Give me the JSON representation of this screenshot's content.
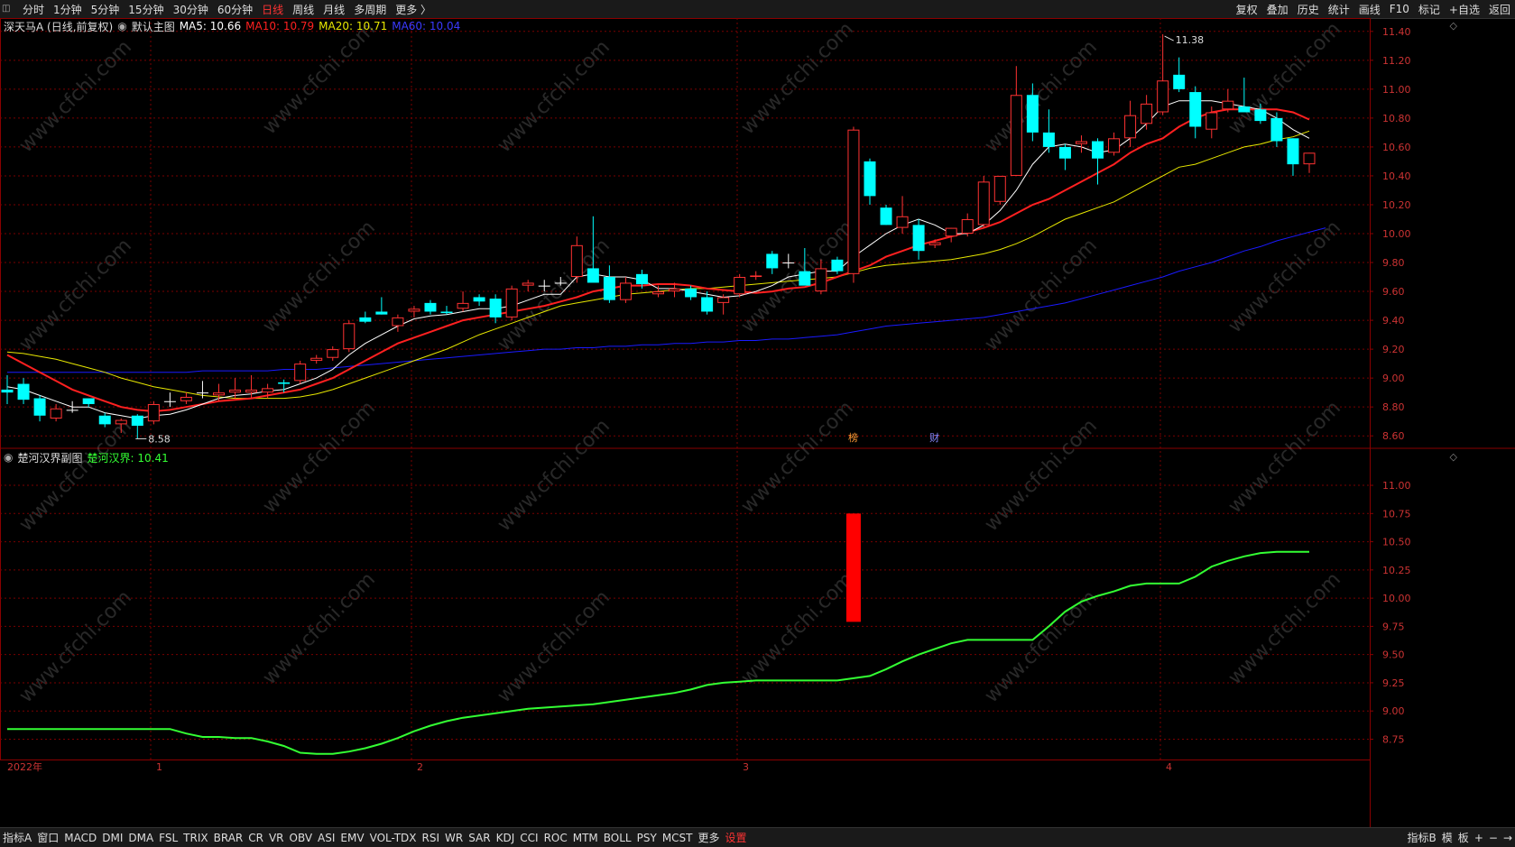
{
  "topbar": {
    "periods": [
      "分时",
      "1分钟",
      "5分钟",
      "15分钟",
      "30分钟",
      "60分钟",
      "日线",
      "周线",
      "月线",
      "多周期",
      "更多 〉"
    ],
    "active_period": "日线",
    "right_items": [
      "复权",
      "叠加",
      "历史",
      "统计",
      "画线",
      "F10",
      "标记",
      "+自选",
      "返回"
    ]
  },
  "main_legend": {
    "stock": "深天马A (日线,前复权)",
    "template": "默认主图",
    "ma5": "MA5: 10.66",
    "ma10": "MA10: 10.79",
    "ma20": "MA20: 10.71",
    "ma60": "MA60: 10.04"
  },
  "sub_legend": {
    "name": "楚河汉界副图",
    "value": "楚河汉界: 10.41"
  },
  "annotations": {
    "high": "11.38",
    "low": "8.58",
    "markers": [
      "榜",
      "财"
    ]
  },
  "x_labels": [
    "2022年",
    "1",
    "2",
    "3",
    "4"
  ],
  "main_y_ticks": [
    "11.40",
    "11.20",
    "11.00",
    "10.80",
    "10.60",
    "10.40",
    "10.20",
    "10.00",
    "9.80",
    "9.60",
    "9.40",
    "9.20",
    "9.00",
    "8.80",
    "8.60"
  ],
  "sub_y_ticks": [
    "11.00",
    "10.75",
    "10.50",
    "10.25",
    "10.00",
    "9.75",
    "9.50",
    "9.25",
    "9.00",
    "8.75"
  ],
  "watermark": "www.cfchi.com",
  "period_tag": "日线",
  "bottombar": {
    "items": [
      "指标A",
      "窗口",
      "MACD",
      "DMI",
      "DMA",
      "FSL",
      "TRIX",
      "BRAR",
      "CR",
      "VR",
      "OBV",
      "ASI",
      "EMV",
      "VOL-TDX",
      "RSI",
      "WR",
      "SAR",
      "KDJ",
      "CCI",
      "ROC",
      "MTM",
      "BOLL",
      "PSY",
      "MCST",
      "更多",
      "设置"
    ],
    "active": "设置",
    "right_items": [
      "指标B",
      "模",
      "板",
      "+",
      "−",
      "→"
    ]
  },
  "colors": {
    "up": "#ff3232",
    "down": "#00ffff",
    "ma5": "#ffffff",
    "ma10": "#ff2020",
    "ma20": "#e8e800",
    "ma60": "#1a1aff",
    "sub_line": "#33ff33",
    "grid": "#7a0000"
  },
  "chart_data": [
    {
      "type": "candlestick",
      "title": "深天马A (日线,前复权)",
      "ylim": [
        8.52,
        11.48
      ],
      "candles": [
        {
          "o": 8.92,
          "h": 9.02,
          "l": 8.82,
          "c": 8.9
        },
        {
          "o": 8.96,
          "h": 9.0,
          "l": 8.82,
          "c": 8.85
        },
        {
          "o": 8.86,
          "h": 8.88,
          "l": 8.7,
          "c": 8.74
        },
        {
          "o": 8.72,
          "h": 8.82,
          "l": 8.7,
          "c": 8.79
        },
        {
          "o": 8.78,
          "h": 8.84,
          "l": 8.76,
          "c": 8.78
        },
        {
          "o": 8.86,
          "h": 8.86,
          "l": 8.8,
          "c": 8.82
        },
        {
          "o": 8.74,
          "h": 8.76,
          "l": 8.66,
          "c": 8.68
        },
        {
          "o": 8.68,
          "h": 8.72,
          "l": 8.62,
          "c": 8.71
        },
        {
          "o": 8.74,
          "h": 8.75,
          "l": 8.58,
          "c": 8.67
        },
        {
          "o": 8.7,
          "h": 8.84,
          "l": 8.68,
          "c": 8.82
        },
        {
          "o": 8.84,
          "h": 8.9,
          "l": 8.8,
          "c": 8.84
        },
        {
          "o": 8.84,
          "h": 8.9,
          "l": 8.82,
          "c": 8.87
        },
        {
          "o": 8.9,
          "h": 8.98,
          "l": 8.86,
          "c": 8.9
        },
        {
          "o": 8.88,
          "h": 8.96,
          "l": 8.84,
          "c": 8.9
        },
        {
          "o": 8.9,
          "h": 9.0,
          "l": 8.86,
          "c": 8.92
        },
        {
          "o": 8.9,
          "h": 9.02,
          "l": 8.86,
          "c": 8.92
        },
        {
          "o": 8.9,
          "h": 8.96,
          "l": 8.86,
          "c": 8.93
        },
        {
          "o": 8.97,
          "h": 8.99,
          "l": 8.9,
          "c": 8.96
        },
        {
          "o": 8.98,
          "h": 9.12,
          "l": 8.96,
          "c": 9.1
        },
        {
          "o": 9.12,
          "h": 9.16,
          "l": 9.1,
          "c": 9.14
        },
        {
          "o": 9.14,
          "h": 9.22,
          "l": 9.12,
          "c": 9.2
        },
        {
          "o": 9.2,
          "h": 9.4,
          "l": 9.18,
          "c": 9.38
        },
        {
          "o": 9.42,
          "h": 9.46,
          "l": 9.38,
          "c": 9.39
        },
        {
          "o": 9.46,
          "h": 9.56,
          "l": 9.44,
          "c": 9.44
        },
        {
          "o": 9.36,
          "h": 9.44,
          "l": 9.32,
          "c": 9.42
        },
        {
          "o": 9.46,
          "h": 9.5,
          "l": 9.42,
          "c": 9.48
        },
        {
          "o": 9.52,
          "h": 9.54,
          "l": 9.44,
          "c": 9.46
        },
        {
          "o": 9.46,
          "h": 9.5,
          "l": 9.44,
          "c": 9.45
        },
        {
          "o": 9.48,
          "h": 9.6,
          "l": 9.46,
          "c": 9.52
        },
        {
          "o": 9.56,
          "h": 9.58,
          "l": 9.5,
          "c": 9.53
        },
        {
          "o": 9.55,
          "h": 9.58,
          "l": 9.38,
          "c": 9.42
        },
        {
          "o": 9.42,
          "h": 9.64,
          "l": 9.4,
          "c": 9.62
        },
        {
          "o": 9.64,
          "h": 9.68,
          "l": 9.6,
          "c": 9.66
        },
        {
          "o": 9.64,
          "h": 9.68,
          "l": 9.6,
          "c": 9.64
        },
        {
          "o": 9.66,
          "h": 9.7,
          "l": 9.64,
          "c": 9.66
        },
        {
          "o": 9.7,
          "h": 9.98,
          "l": 9.66,
          "c": 9.92
        },
        {
          "o": 9.76,
          "h": 10.12,
          "l": 9.72,
          "c": 9.66
        },
        {
          "o": 9.7,
          "h": 9.78,
          "l": 9.52,
          "c": 9.54
        },
        {
          "o": 9.54,
          "h": 9.7,
          "l": 9.52,
          "c": 9.66
        },
        {
          "o": 9.72,
          "h": 9.75,
          "l": 9.62,
          "c": 9.65
        },
        {
          "o": 9.58,
          "h": 9.64,
          "l": 9.56,
          "c": 9.6
        },
        {
          "o": 9.6,
          "h": 9.66,
          "l": 9.56,
          "c": 9.62
        },
        {
          "o": 9.62,
          "h": 9.64,
          "l": 9.54,
          "c": 9.56
        },
        {
          "o": 9.56,
          "h": 9.6,
          "l": 9.44,
          "c": 9.46
        },
        {
          "o": 9.52,
          "h": 9.58,
          "l": 9.44,
          "c": 9.56
        },
        {
          "o": 9.58,
          "h": 9.72,
          "l": 9.56,
          "c": 9.7
        },
        {
          "o": 9.7,
          "h": 9.74,
          "l": 9.68,
          "c": 9.71
        },
        {
          "o": 9.86,
          "h": 9.88,
          "l": 9.72,
          "c": 9.76
        },
        {
          "o": 9.8,
          "h": 9.86,
          "l": 9.76,
          "c": 9.8
        },
        {
          "o": 9.74,
          "h": 9.9,
          "l": 9.7,
          "c": 9.64
        },
        {
          "o": 9.6,
          "h": 9.82,
          "l": 9.58,
          "c": 9.76
        },
        {
          "o": 9.82,
          "h": 9.84,
          "l": 9.72,
          "c": 9.74
        },
        {
          "o": 9.72,
          "h": 10.74,
          "l": 9.66,
          "c": 10.72
        },
        {
          "o": 10.5,
          "h": 10.52,
          "l": 10.2,
          "c": 10.26
        },
        {
          "o": 10.18,
          "h": 10.2,
          "l": 10.06,
          "c": 10.06
        },
        {
          "o": 10.04,
          "h": 10.26,
          "l": 10.0,
          "c": 10.12
        },
        {
          "o": 10.06,
          "h": 10.1,
          "l": 9.82,
          "c": 9.88
        },
        {
          "o": 9.92,
          "h": 9.96,
          "l": 9.9,
          "c": 9.94
        },
        {
          "o": 9.98,
          "h": 10.04,
          "l": 9.94,
          "c": 10.04
        },
        {
          "o": 10.0,
          "h": 10.14,
          "l": 9.98,
          "c": 10.1
        },
        {
          "o": 10.06,
          "h": 10.4,
          "l": 10.04,
          "c": 10.36
        },
        {
          "o": 10.22,
          "h": 10.4,
          "l": 10.2,
          "c": 10.4
        },
        {
          "o": 10.4,
          "h": 11.16,
          "l": 10.4,
          "c": 10.96
        },
        {
          "o": 10.96,
          "h": 11.04,
          "l": 10.64,
          "c": 10.7
        },
        {
          "o": 10.7,
          "h": 10.86,
          "l": 10.56,
          "c": 10.6
        },
        {
          "o": 10.6,
          "h": 10.62,
          "l": 10.44,
          "c": 10.52
        },
        {
          "o": 10.62,
          "h": 10.68,
          "l": 10.56,
          "c": 10.64
        },
        {
          "o": 10.64,
          "h": 10.66,
          "l": 10.34,
          "c": 10.52
        },
        {
          "o": 10.56,
          "h": 10.7,
          "l": 10.54,
          "c": 10.66
        },
        {
          "o": 10.66,
          "h": 10.92,
          "l": 10.6,
          "c": 10.82
        },
        {
          "o": 10.76,
          "h": 10.96,
          "l": 10.72,
          "c": 10.9
        },
        {
          "o": 10.84,
          "h": 11.38,
          "l": 10.82,
          "c": 11.06
        },
        {
          "o": 11.1,
          "h": 11.22,
          "l": 10.98,
          "c": 11.0
        },
        {
          "o": 10.98,
          "h": 11.02,
          "l": 10.66,
          "c": 10.74
        },
        {
          "o": 10.72,
          "h": 10.88,
          "l": 10.66,
          "c": 10.84
        },
        {
          "o": 10.86,
          "h": 11.0,
          "l": 10.84,
          "c": 10.92
        },
        {
          "o": 10.88,
          "h": 11.08,
          "l": 10.84,
          "c": 10.84
        },
        {
          "o": 10.86,
          "h": 10.9,
          "l": 10.76,
          "c": 10.78
        },
        {
          "o": 10.8,
          "h": 10.84,
          "l": 10.6,
          "c": 10.64
        },
        {
          "o": 10.66,
          "h": 10.66,
          "l": 10.4,
          "c": 10.48
        },
        {
          "o": 10.48,
          "h": 10.56,
          "l": 10.42,
          "c": 10.56
        }
      ],
      "ma5": [
        8.94,
        8.92,
        8.88,
        8.84,
        8.8,
        8.8,
        8.76,
        8.74,
        8.72,
        8.74,
        8.75,
        8.78,
        8.82,
        8.86,
        8.88,
        8.89,
        8.91,
        8.92,
        8.96,
        9.0,
        9.06,
        9.16,
        9.24,
        9.3,
        9.36,
        9.41,
        9.43,
        9.44,
        9.46,
        9.48,
        9.48,
        9.5,
        9.54,
        9.58,
        9.58,
        9.7,
        9.72,
        9.7,
        9.7,
        9.68,
        9.62,
        9.62,
        9.6,
        9.58,
        9.56,
        9.57,
        9.6,
        9.64,
        9.7,
        9.72,
        9.74,
        9.74,
        9.84,
        9.92,
        10.0,
        10.06,
        10.1,
        10.06,
        10.0,
        10.0,
        10.06,
        10.16,
        10.3,
        10.48,
        10.6,
        10.62,
        10.6,
        10.56,
        10.58,
        10.66,
        10.76,
        10.88,
        10.92,
        10.92,
        10.92,
        10.9,
        10.88,
        10.86,
        10.8,
        10.72,
        10.66
      ],
      "ma10": [
        9.16,
        9.1,
        9.04,
        8.98,
        8.92,
        8.88,
        8.84,
        8.8,
        8.78,
        8.77,
        8.78,
        8.8,
        8.82,
        8.84,
        8.85,
        8.86,
        8.88,
        8.9,
        8.92,
        8.96,
        9.0,
        9.06,
        9.12,
        9.18,
        9.24,
        9.28,
        9.32,
        9.36,
        9.4,
        9.42,
        9.44,
        9.46,
        9.48,
        9.5,
        9.53,
        9.56,
        9.6,
        9.62,
        9.64,
        9.64,
        9.65,
        9.65,
        9.64,
        9.62,
        9.61,
        9.6,
        9.59,
        9.6,
        9.62,
        9.63,
        9.66,
        9.7,
        9.74,
        9.78,
        9.84,
        9.88,
        9.92,
        9.95,
        9.98,
        10.01,
        10.04,
        10.08,
        10.14,
        10.2,
        10.24,
        10.3,
        10.36,
        10.42,
        10.48,
        10.56,
        10.62,
        10.66,
        10.74,
        10.8,
        10.84,
        10.86,
        10.86,
        10.86,
        10.86,
        10.84,
        10.79
      ],
      "ma20": [
        9.18,
        9.17,
        9.15,
        9.13,
        9.1,
        9.07,
        9.04,
        9.0,
        8.97,
        8.94,
        8.92,
        8.9,
        8.88,
        8.87,
        8.86,
        8.86,
        8.86,
        8.86,
        8.87,
        8.89,
        8.92,
        8.96,
        9.0,
        9.04,
        9.08,
        9.12,
        9.16,
        9.2,
        9.25,
        9.3,
        9.34,
        9.38,
        9.42,
        9.46,
        9.5,
        9.52,
        9.54,
        9.56,
        9.58,
        9.59,
        9.6,
        9.61,
        9.62,
        9.62,
        9.63,
        9.64,
        9.65,
        9.66,
        9.67,
        9.68,
        9.69,
        9.7,
        9.73,
        9.76,
        9.78,
        9.79,
        9.8,
        9.81,
        9.82,
        9.84,
        9.86,
        9.89,
        9.93,
        9.98,
        10.04,
        10.1,
        10.14,
        10.18,
        10.22,
        10.28,
        10.34,
        10.4,
        10.46,
        10.48,
        10.52,
        10.56,
        10.6,
        10.62,
        10.65,
        10.67,
        10.71
      ],
      "ma60": [
        9.04,
        9.04,
        9.04,
        9.04,
        9.04,
        9.04,
        9.04,
        9.04,
        9.04,
        9.04,
        9.04,
        9.04,
        9.05,
        9.05,
        9.05,
        9.05,
        9.05,
        9.06,
        9.06,
        9.06,
        9.07,
        9.08,
        9.09,
        9.1,
        9.11,
        9.12,
        9.13,
        9.14,
        9.15,
        9.16,
        9.17,
        9.18,
        9.19,
        9.2,
        9.2,
        9.21,
        9.21,
        9.22,
        9.22,
        9.23,
        9.23,
        9.24,
        9.24,
        9.25,
        9.25,
        9.26,
        9.26,
        9.27,
        9.27,
        9.28,
        9.29,
        9.3,
        9.32,
        9.34,
        9.36,
        9.37,
        9.38,
        9.39,
        9.4,
        9.41,
        9.42,
        9.44,
        9.46,
        9.48,
        9.5,
        9.52,
        9.55,
        9.58,
        9.61,
        9.64,
        9.67,
        9.7,
        9.74,
        9.77,
        9.8,
        9.84,
        9.88,
        9.91,
        9.95,
        9.98,
        10.01,
        10.04
      ]
    },
    {
      "type": "line",
      "title": "楚河汉界副图",
      "ylim": [
        8.57,
        11.32
      ],
      "series": [
        {
          "name": "楚河汉界",
          "values": [
            8.84,
            8.84,
            8.84,
            8.84,
            8.84,
            8.84,
            8.84,
            8.84,
            8.84,
            8.84,
            8.84,
            8.8,
            8.77,
            8.77,
            8.76,
            8.76,
            8.73,
            8.69,
            8.63,
            8.62,
            8.62,
            8.64,
            8.67,
            8.71,
            8.76,
            8.82,
            8.87,
            8.91,
            8.94,
            8.96,
            8.98,
            9.0,
            9.02,
            9.03,
            9.04,
            9.05,
            9.06,
            9.08,
            9.1,
            9.12,
            9.14,
            9.16,
            9.19,
            9.23,
            9.25,
            9.26,
            9.27,
            9.27,
            9.27,
            9.27,
            9.27,
            9.27,
            9.29,
            9.31,
            9.37,
            9.44,
            9.5,
            9.55,
            9.6,
            9.63,
            9.63,
            9.63,
            9.63,
            9.63,
            9.75,
            9.88,
            9.97,
            10.02,
            10.06,
            10.11,
            10.13,
            10.13,
            10.13,
            10.19,
            10.28,
            10.33,
            10.37,
            10.4,
            10.41,
            10.41,
            10.41
          ]
        }
      ],
      "bars": [
        {
          "index": 52,
          "from": 9.79,
          "to": 10.75
        }
      ]
    }
  ]
}
